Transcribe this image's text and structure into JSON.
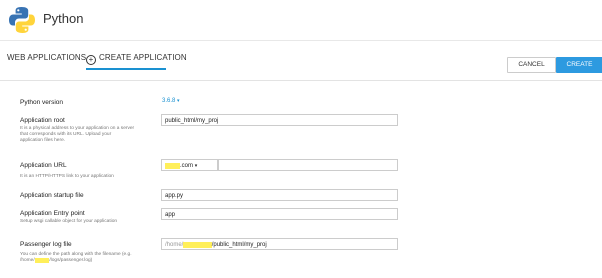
{
  "header": {
    "app_title": "Python",
    "logo_icon": "python-logo-icon",
    "colors": {
      "blue": "#3873b3",
      "yellow": "#ffd43b"
    }
  },
  "tabs": {
    "web_applications": "WEB APPLICATIONS",
    "create_application": "CREATE APPLICATION",
    "accent_color": "#1a91d1"
  },
  "buttons": {
    "cancel": "CANCEL",
    "create": "CREATE",
    "create_color": "#2d9ae0"
  },
  "form": {
    "python_version": {
      "label": "Python version",
      "value": "3.6.8",
      "caret": "▾"
    },
    "app_root": {
      "label": "Application root",
      "help_lines": [
        "It is a physical address to your application on a server",
        "that corresponds with its URL. Upload your",
        "application files here."
      ],
      "value": "public_html/my_proj"
    },
    "app_url": {
      "label": "Application URL",
      "help": "It is an HTTP/HTTPS link to your application",
      "domain_suffix": ".com",
      "caret": "▾",
      "path_value": ""
    },
    "startup_file": {
      "label": "Application startup file",
      "value": "app.py"
    },
    "entry_point": {
      "label": "Application Entry point",
      "help": "Setup wsgi callable object for your application",
      "value": "app"
    },
    "passenger_log": {
      "label": "Passenger log file",
      "help_lines": [
        "You can define the path along with the filename (e.g.",
        "/home/",
        "/logs/passenger.log)"
      ],
      "value_prefix": "/home/",
      "value_suffix": "/public_html/my_proj"
    }
  }
}
